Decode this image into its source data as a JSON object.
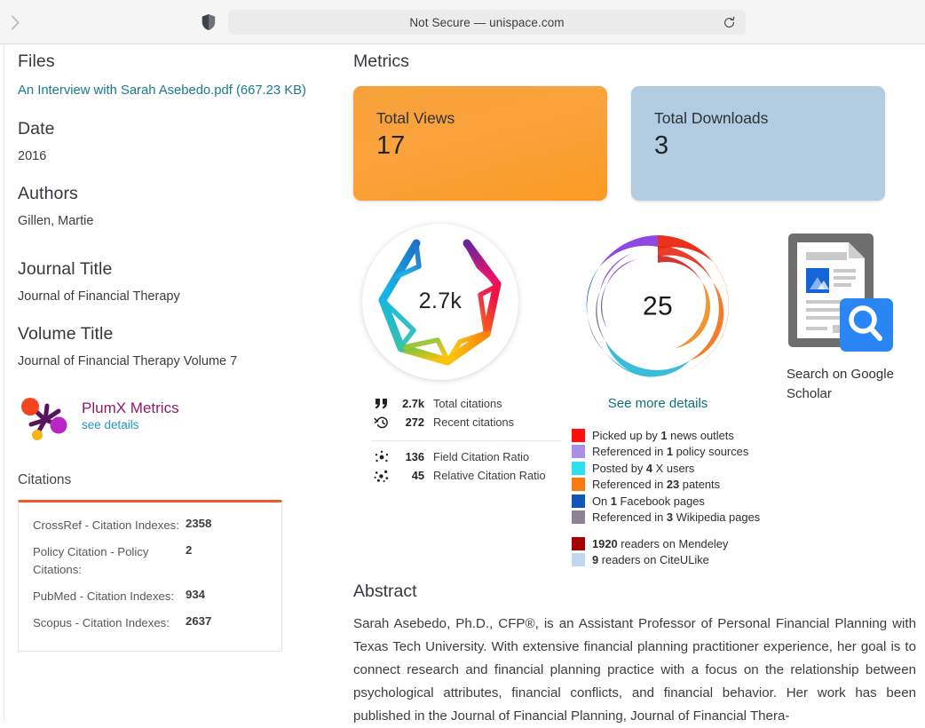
{
  "browser": {
    "back_icon": "chevron-right-icon",
    "shield_icon": "shield-privacy-icon",
    "address": "Not Secure — unispace.com",
    "reload_icon": "reload-icon"
  },
  "sidebar": {
    "files": {
      "heading": "Files",
      "file_link": "An Interview with Sarah Asebedo.pdf (667.23 KB)"
    },
    "date": {
      "heading": "Date",
      "value": "2016"
    },
    "authors": {
      "heading": "Authors",
      "value": "Gillen, Martie"
    },
    "journal_title": {
      "heading": "Journal Title",
      "value": "Journal of Financial Therapy"
    },
    "volume_title": {
      "heading": "Volume Title",
      "value": "Journal of Financial Therapy Volume 7"
    },
    "plumx": {
      "title": "PlumX Metrics",
      "link": "see details",
      "icon": "plumx-logo-icon",
      "title_color": "#8e1a6b",
      "link_color": "#2196c4"
    },
    "citations": {
      "label": "Citations",
      "accent_color": "#f05a28",
      "rows": [
        {
          "name": "CrossRef - Citation Indexes:",
          "value": "2358"
        },
        {
          "name": "Policy Citation - Policy Citations:",
          "value": "2"
        },
        {
          "name": "PubMed - Citation Indexes:",
          "value": "934"
        },
        {
          "name": "Scopus - Citation Indexes:",
          "value": "2637"
        }
      ]
    }
  },
  "main": {
    "metrics_heading": "Metrics",
    "cards": [
      {
        "label": "Total Views",
        "value": "17",
        "color": "#fba234"
      },
      {
        "label": "Total Downloads",
        "value": "3",
        "color": "#b2cde2"
      }
    ],
    "dimensions": {
      "badge_number": "2.7k",
      "rows_primary": [
        {
          "icon": "quote-icon",
          "value": "2.7k",
          "label": "Total citations"
        },
        {
          "icon": "recent-clock-icon",
          "value": "272",
          "label": "Recent citations"
        }
      ],
      "rows_secondary": [
        {
          "icon": "field-citation-ratio-icon",
          "value": "136",
          "label": "Field Citation Ratio"
        },
        {
          "icon": "relative-citation-ratio-icon",
          "value": "45",
          "label": "Relative Citation Ratio"
        }
      ]
    },
    "altmetric": {
      "score": "25",
      "more_link": "See more details",
      "legend_primary": [
        {
          "color": "#ff0f0f",
          "prefix": "Picked up by ",
          "count": "1",
          "suffix": " news outlets"
        },
        {
          "color": "#a98fe8",
          "prefix": "Referenced in ",
          "count": "1",
          "suffix": " policy sources"
        },
        {
          "color": "#2ee0ee",
          "prefix": "Posted by ",
          "count": "4",
          "suffix": " X users"
        },
        {
          "color": "#f97a0d",
          "prefix": "Referenced in ",
          "count": "23",
          "suffix": " patents"
        },
        {
          "color": "#1155b8",
          "prefix": "On ",
          "count": "1",
          "suffix": " Facebook pages"
        },
        {
          "color": "#8d8395",
          "prefix": "Referenced in ",
          "count": "3",
          "suffix": " Wikipedia pages"
        }
      ],
      "legend_secondary": [
        {
          "color": "#a50005",
          "count": "1920",
          "suffix": " readers on Mendeley"
        },
        {
          "color": "#c0d8ee",
          "count": "9",
          "suffix": " readers on CiteULike"
        }
      ]
    },
    "scholar": {
      "icon": "google-scholar-document-search-icon",
      "label": "Search on Google Scholar"
    }
  },
  "abstract": {
    "heading": "Abstract",
    "text": "Sarah Asebedo, Ph.D., CFP®, is an Assistant Professor of Personal Financial Planning with Texas Tech University. With extensive financial planning practitioner experience, her goal is to connect research and financial planning practice with a focus on the relationship between psychological attributes, financial conflicts, and financial behavior. Her work has been published in the Journal of Financial Planning, Journal of Financial Thera-"
  }
}
